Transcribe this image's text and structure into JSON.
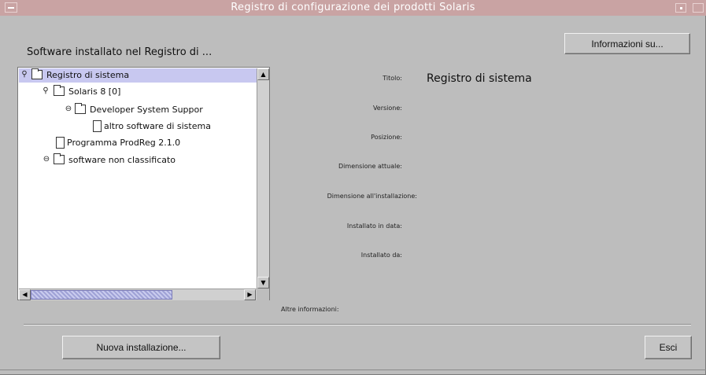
{
  "window": {
    "title": "Registro di configurazione dei prodotti Solaris"
  },
  "toolbar": {
    "info_button": "Informazioni su..."
  },
  "tree_panel": {
    "title": "Software installato nel Registro di ...",
    "nodes": [
      {
        "label": "Registro di sistema",
        "toggle": "expanded",
        "icon": "folder-icon",
        "selected": true
      },
      {
        "label": "Solaris 8   [0]",
        "toggle": "expanded",
        "icon": "folder-icon"
      },
      {
        "label": "Developer System Suppor",
        "toggle": "collapsed",
        "icon": "folder-icon"
      },
      {
        "label": "altro software di sistema",
        "toggle": "none",
        "icon": "document-icon"
      },
      {
        "label": "Programma ProdReg  2.1.0",
        "toggle": "none",
        "icon": "document-icon"
      },
      {
        "label": "software non classificato",
        "toggle": "collapsed",
        "icon": "folder-icon"
      }
    ],
    "scroll_up_glyph": "▲",
    "scroll_down_glyph": "▼",
    "scroll_left_glyph": "◀",
    "scroll_right_glyph": "▶"
  },
  "details": {
    "labels": {
      "title": "Titolo:",
      "version": "Versione:",
      "location": "Posizione:",
      "current_size": "Dimensione attuale:",
      "install_size": "Dimensione all'installazione:",
      "installed_on": "Installato in data:",
      "installed_by": "Installato da:",
      "more_info": "Altre informazioni:"
    },
    "values": {
      "title": "Registro di sistema"
    }
  },
  "footer": {
    "new_install_button": "Nuova installazione...",
    "exit_button": "Esci"
  },
  "colors": {
    "title_bar": "#c9a3a3",
    "window_bg": "#bdbdbd",
    "selection": "#c8c8f0",
    "scroll_thumb": "#9fa2d6"
  }
}
